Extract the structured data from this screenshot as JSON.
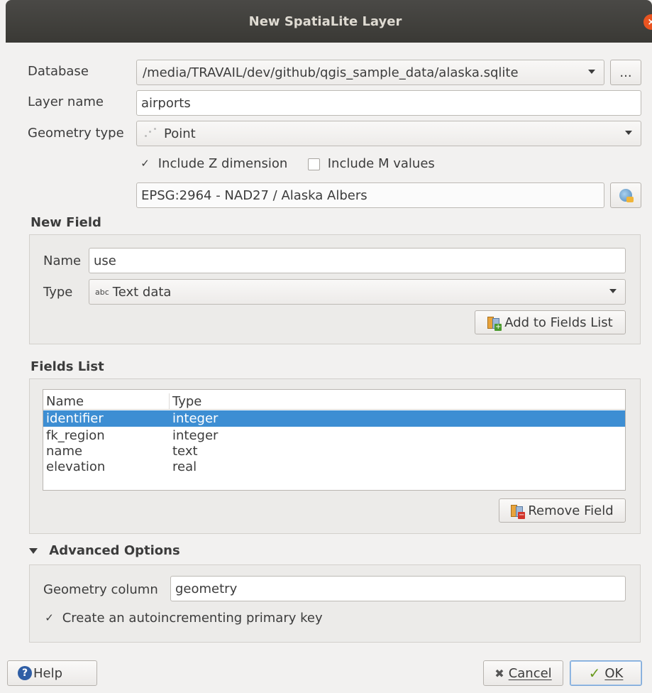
{
  "window": {
    "title": "New SpatiaLite Layer",
    "close_glyph": "×"
  },
  "database": {
    "label": "Database",
    "value": "/media/TRAVAIL/dev/github/qgis_sample_data/alaska.sqlite",
    "browse_label": "..."
  },
  "layer_name": {
    "label": "Layer name",
    "value": "airports"
  },
  "geometry_type": {
    "label": "Geometry type",
    "value": "Point"
  },
  "include_z": {
    "label": "Include Z dimension",
    "checked": true
  },
  "include_m": {
    "label": "Include M values",
    "checked": false
  },
  "crs": {
    "value": "EPSG:2964 - NAD27 / Alaska Albers"
  },
  "new_field": {
    "title": "New Field",
    "name_label": "Name",
    "name_value": "use",
    "type_label": "Type",
    "type_prefix": "abc",
    "type_value": "Text data",
    "add_button": "Add to Fields List"
  },
  "fields_list": {
    "title": "Fields List",
    "columns": [
      "Name",
      "Type"
    ],
    "rows": [
      {
        "name": "identifier",
        "type": "integer",
        "selected": true
      },
      {
        "name": "fk_region",
        "type": "integer",
        "selected": false
      },
      {
        "name": "name",
        "type": "text",
        "selected": false
      },
      {
        "name": "elevation",
        "type": "real",
        "selected": false
      }
    ],
    "remove_button": "Remove Field"
  },
  "advanced": {
    "title": "Advanced Options",
    "geometry_column_label": "Geometry column",
    "geometry_column_value": "geometry",
    "autoinc_label": "Create an autoincrementing primary key",
    "autoinc_checked": true
  },
  "footer": {
    "help": "Help",
    "cancel": "Cancel",
    "ok": "OK"
  },
  "colors": {
    "selection": "#3d8ed3",
    "accent": "#e95420"
  }
}
